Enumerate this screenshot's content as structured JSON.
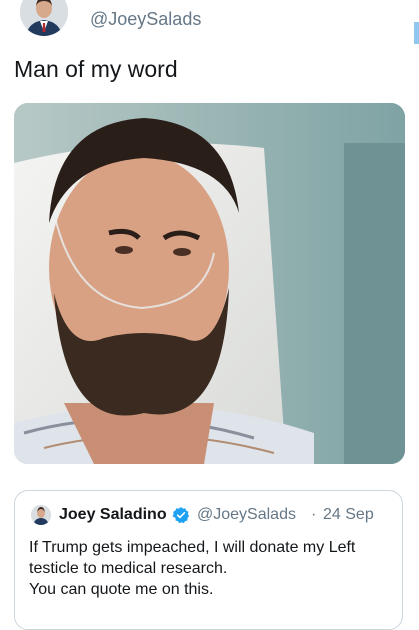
{
  "author": {
    "handle": "@JoeySalads"
  },
  "tweet": {
    "text": "Man of my word"
  },
  "photo": {
    "description_icon": "hospital-selfie-photo"
  },
  "quote": {
    "name": "Joey Saladino",
    "handle": "@JoeySalads",
    "separator": "·",
    "date": "24 Sep",
    "lines": [
      "If Trump gets impeached, I will donate my Left",
      "testicle to medical research.",
      "You can quote me on this."
    ]
  },
  "colors": {
    "verified": "#1da1f2",
    "secondary_text": "#657786",
    "border": "#ccd6dd"
  }
}
